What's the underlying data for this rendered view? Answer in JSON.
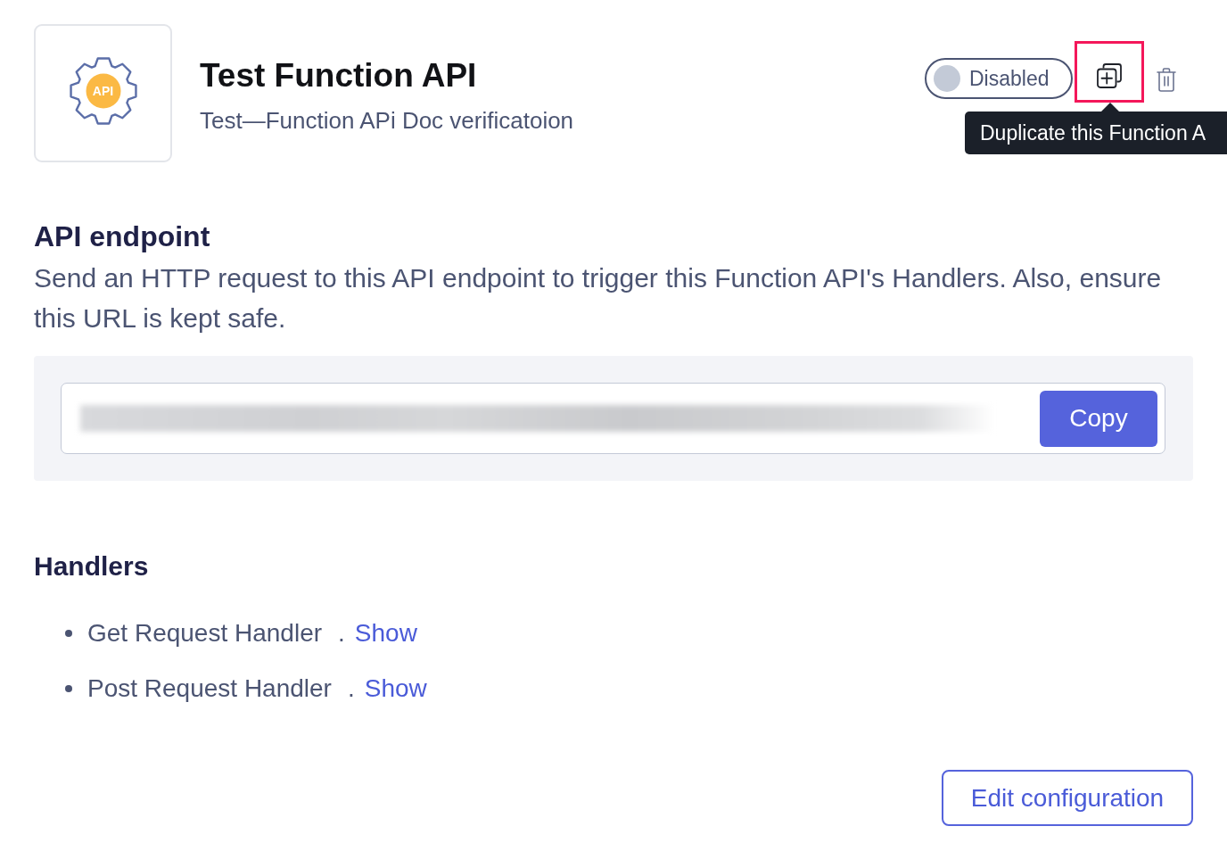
{
  "header": {
    "logo_text": "API",
    "title": "Test Function API",
    "subtitle": "Test—Function APi Doc verificatoion",
    "status_toggle": {
      "label": "Disabled",
      "on": false
    },
    "actions": [
      {
        "kind": "duplicate",
        "highlighted": true
      },
      {
        "kind": "delete",
        "highlighted": false
      }
    ],
    "tooltip": "Duplicate this Function A"
  },
  "endpoint": {
    "heading": "API endpoint",
    "description": "Send an HTTP request to this API endpoint to trigger this Function API's Handlers. Also, ensure this URL is kept safe.",
    "copy_button": "Copy"
  },
  "handlers": {
    "heading": "Handlers",
    "items": [
      {
        "name": "Get Request Handler",
        "separator": ".",
        "link": "Show"
      },
      {
        "name": "Post Request Handler",
        "separator": ".",
        "link": "Show"
      }
    ]
  },
  "edit_button": "Edit configuration"
}
